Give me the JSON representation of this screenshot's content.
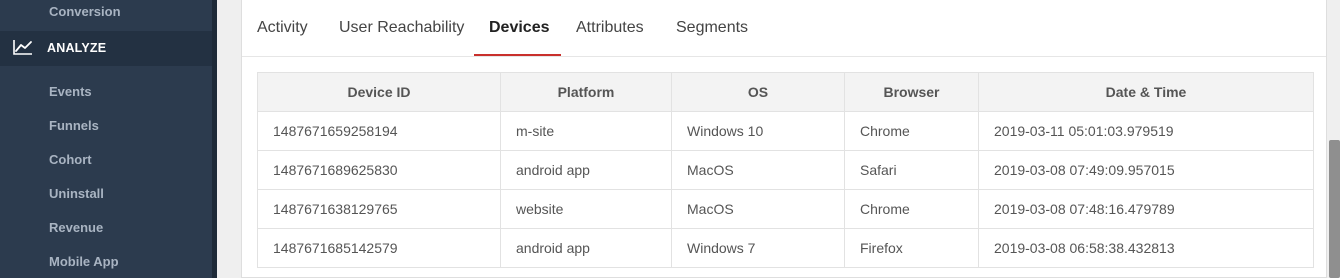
{
  "sidebar": {
    "top_item": "Conversion",
    "section": {
      "label": "ANALYZE",
      "icon": "line-chart-icon"
    },
    "items": [
      "Events",
      "Funnels",
      "Cohort",
      "Uninstall",
      "Revenue",
      "Mobile App"
    ]
  },
  "tabs": [
    {
      "label": "Activity",
      "active": false
    },
    {
      "label": "User Reachability",
      "active": false
    },
    {
      "label": "Devices",
      "active": true
    },
    {
      "label": "Attributes",
      "active": false
    },
    {
      "label": "Segments",
      "active": false
    }
  ],
  "table": {
    "headers": [
      "Device ID",
      "Platform",
      "OS",
      "Browser",
      "Date & Time"
    ],
    "rows": [
      [
        "1487671659258194",
        "m-site",
        "Windows 10",
        "Chrome",
        "2019-03-11 05:01:03.979519"
      ],
      [
        "1487671689625830",
        "android app",
        "MacOS",
        "Safari",
        "2019-03-08 07:49:09.957015"
      ],
      [
        "1487671638129765",
        "website",
        "MacOS",
        "Chrome",
        "2019-03-08 07:48:16.479789"
      ],
      [
        "1487671685142579",
        "android app",
        "Windows 7",
        "Firefox",
        "2019-03-08 06:58:38.432813"
      ]
    ]
  },
  "colors": {
    "sidebar_bg": "#2c3b4e",
    "active_tab_accent": "#c9302c"
  }
}
